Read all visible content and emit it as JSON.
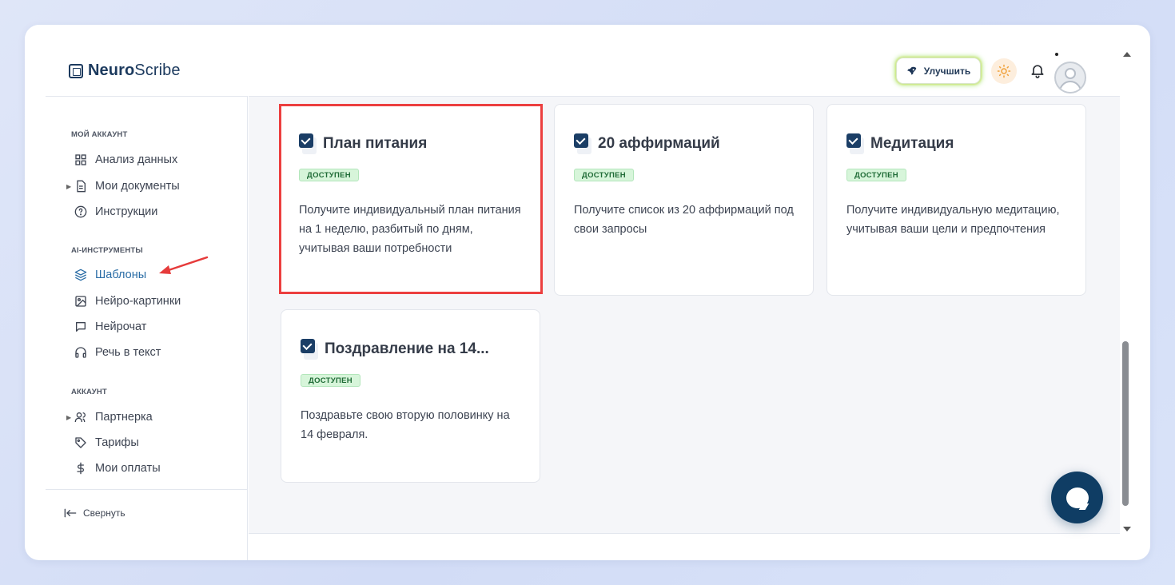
{
  "app": {
    "logo_bold": "Neuro",
    "logo_regular": "Scribe"
  },
  "header": {
    "upgrade_label": "Улучшить"
  },
  "sidebar": {
    "sections": {
      "my_account": "МОЙ АККАУНТ",
      "ai_tools": "AI-ИНСТРУМЕНТЫ",
      "account": "АККАУНТ"
    },
    "items": [
      {
        "label": "Анализ данных",
        "icon": "grid-icon"
      },
      {
        "label": "Мои документы",
        "icon": "document-icon",
        "expandable": true
      },
      {
        "label": "Инструкции",
        "icon": "help-circle-icon"
      },
      {
        "label": "Шаблоны",
        "icon": "layers-icon",
        "active": true
      },
      {
        "label": "Нейро-картинки",
        "icon": "image-icon"
      },
      {
        "label": "Нейрочат",
        "icon": "chat-icon"
      },
      {
        "label": "Речь в текст",
        "icon": "headphones-icon"
      },
      {
        "label": "Партнерка",
        "icon": "users-icon",
        "expandable": true
      },
      {
        "label": "Тарифы",
        "icon": "tag-icon"
      },
      {
        "label": "Мои оплаты",
        "icon": "dollar-icon"
      }
    ],
    "collapse_label": "Свернуть"
  },
  "cards": [
    {
      "title": "План питания",
      "badge": "ДОСТУПЕН",
      "description": "Получите индивидуальный план питания на 1 неделю, разбитый по дням, учитывая ваши потребности",
      "highlighted": true
    },
    {
      "title": "20 аффирмаций",
      "badge": "ДОСТУПЕН",
      "description": "Получите список из 20 аффирмаций под свои запросы"
    },
    {
      "title": "Медитация",
      "badge": "ДОСТУПЕН",
      "description": "Получите индивидуальную медитацию, учитывая ваши цели и предпочтения"
    },
    {
      "title": "Поздравление на 14...",
      "badge": "ДОСТУПЕН",
      "description": "Поздравьте свою вторую половинку на 14 февраля."
    }
  ],
  "colors": {
    "brand": "#1c3a5e",
    "active_nav": "#2b6da6",
    "highlight_border": "#ec3f3f",
    "badge_bg": "#d7f5da",
    "badge_text": "#1f6b36",
    "chat_button": "#0f3d64"
  }
}
